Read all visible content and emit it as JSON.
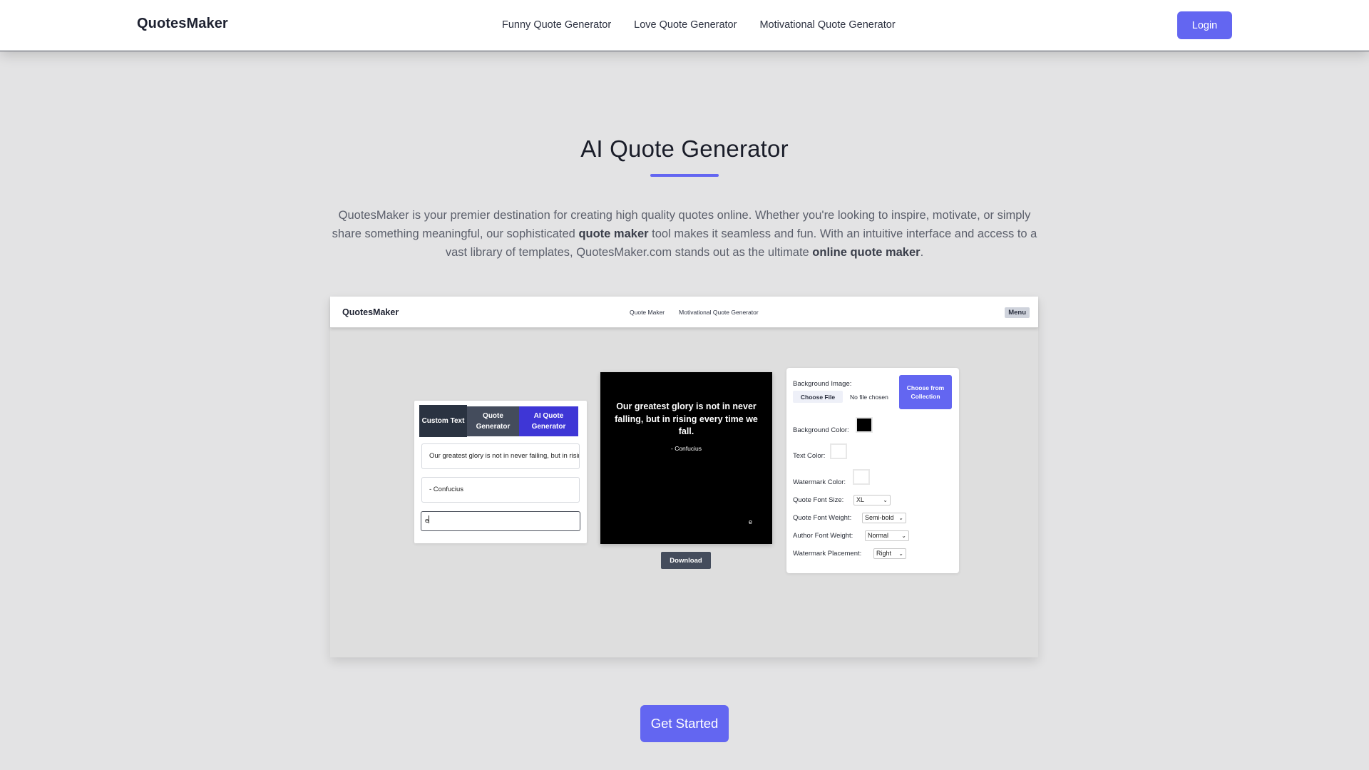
{
  "header": {
    "brand": "QuotesMaker",
    "nav": [
      "Funny Quote Generator",
      "Love Quote Generator",
      "Motivational Quote Generator"
    ],
    "login_label": "Login"
  },
  "hero": {
    "title": "AI Quote Generator",
    "desc_part1": "QuotesMaker is your premier destination for creating high quality quotes online. Whether you're looking to inspire, motivate, or simply share something meaningful, our sophisticated ",
    "desc_bold1": "quote maker",
    "desc_part2": " tool makes it seamless and fun. With an intuitive interface and access to a vast library of templates, QuotesMaker.com stands out as the ultimate ",
    "desc_bold2": "online quote maker",
    "desc_part3": "."
  },
  "mockup": {
    "brand": "QuotesMaker",
    "nav": [
      "Quote Maker",
      "Motivational Quote Generator"
    ],
    "menu_label": "Menu",
    "tabs": [
      {
        "label": "Custom Text",
        "active": true
      },
      {
        "label": "Quote Generator",
        "active": false
      },
      {
        "label": "AI Quote Generator",
        "active": false
      }
    ],
    "fields": {
      "quote_value": "Our greatest glory is not in never failing, but in rising every time we fall.",
      "author_value": "- Confucius",
      "watermark_value": "e"
    },
    "preview": {
      "quote": "Our greatest glory is not in never falling, but in rising every time we fall.",
      "author": "- Confucius",
      "watermark": "e",
      "background_color": "#000000",
      "text_color": "#ffffff"
    },
    "download_label": "Download",
    "settings": {
      "bg_image_label": "Background Image:",
      "choose_file_label": "Choose File",
      "no_file_label": "No file chosen",
      "collection_label": "Choose from Collection",
      "bg_color_label": "Background Color:",
      "bg_color_value": "#000000",
      "text_color_label": "Text Color:",
      "text_color_value": "#ffffff",
      "watermark_color_label": "Watermark Color:",
      "watermark_color_value": "#ffffff",
      "quote_font_size_label": "Quote Font Size:",
      "quote_font_size_value": "XL",
      "quote_font_weight_label": "Quote Font Weight:",
      "quote_font_weight_value": "Semi-bold",
      "author_font_weight_label": "Author Font Weight:",
      "author_font_weight_value": "Normal",
      "watermark_placement_label": "Watermark Placement:",
      "watermark_placement_value": "Right"
    }
  },
  "cta": {
    "label": "Get Started"
  },
  "colors": {
    "accent": "#6366f1",
    "tab_dark": "#2a3341",
    "tab_mid": "#444c5c",
    "tab_ai": "#3e36d6",
    "page_bg": "#e3e3e4"
  }
}
